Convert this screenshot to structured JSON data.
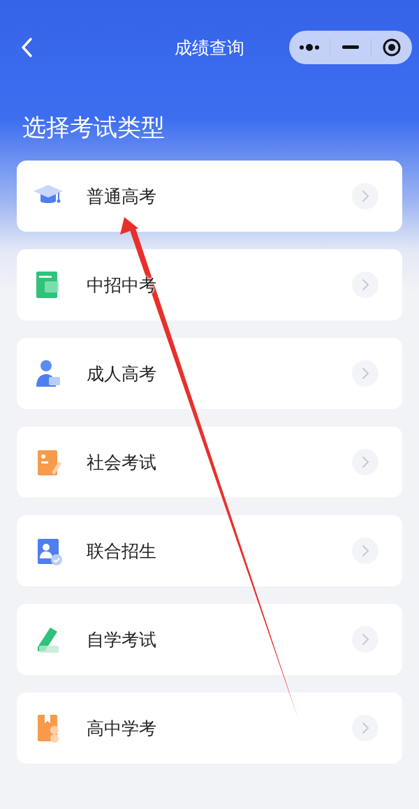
{
  "nav": {
    "title": "成绩查询"
  },
  "heading": "选择考试类型",
  "items": [
    {
      "label": "普通高考",
      "kind": "cap"
    },
    {
      "label": "中招中考",
      "kind": "greendoc"
    },
    {
      "label": "成人高考",
      "kind": "person"
    },
    {
      "label": "社会考试",
      "kind": "orangedoc"
    },
    {
      "label": "联合招生",
      "kind": "badge"
    },
    {
      "label": "自学考试",
      "kind": "pencil"
    },
    {
      "label": "高中学考",
      "kind": "book"
    }
  ]
}
